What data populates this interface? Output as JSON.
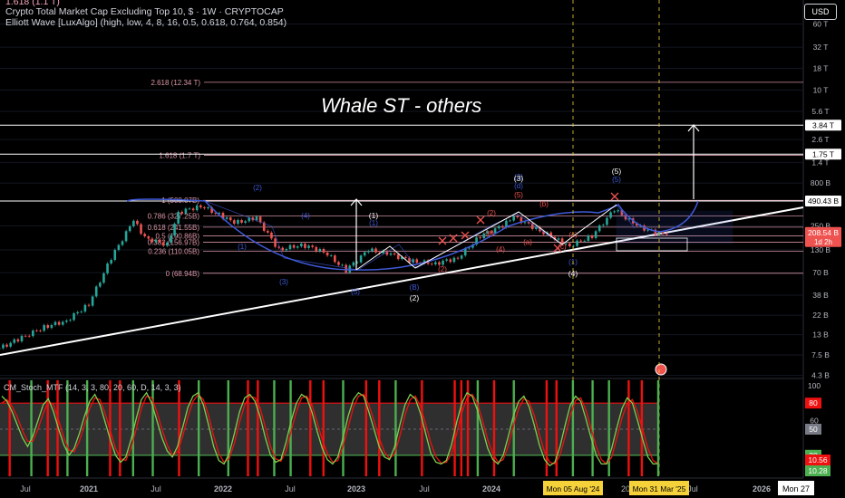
{
  "header": {
    "title": "Crypto Total Market Cap Excluding Top 10, $ · 1W · CRYPTOCAP",
    "indicator": "Elliott Wave [LuxAlgo] (high, low, 4, 8, 16, 0.5, 0.618, 0.764, 0.854)",
    "top_fib_cut": "1.618 (1.1 T)"
  },
  "currency_button": "USD",
  "annotation": "Whale ST - others",
  "colors": {
    "background": "#000000",
    "candle_up": "#26a69a",
    "candle_down": "#ef5350",
    "fib_line": "#f4a7b9",
    "wave_blue": "#3f5ad8",
    "wave_white": "#ffffff",
    "trendline": "#ffffff",
    "stoch_green": "#4caf50",
    "stoch_red": "#ef1010",
    "stoch_fill": "#555555",
    "date_highlight": "#f5d13a"
  },
  "chart_data": [
    {
      "type": "candlestick",
      "scale": "log",
      "ylim": [
        "4.3 B",
        "60 T"
      ],
      "y_ticks": [
        "60 T",
        "32 T",
        "18 T",
        "10 T",
        "5.6 T",
        "2.6 T",
        "1.4 T",
        "800 B",
        "490.43 B",
        "250 B",
        "130 B",
        "70 B",
        "38 B",
        "22 B",
        "13 B",
        "7.5 B",
        "4.3 B"
      ],
      "x_ticks": [
        "Jul",
        "2021",
        "Jul",
        "2022",
        "Jul",
        "2023",
        "Jul",
        "2024",
        "Jul",
        "20",
        "Jul",
        "2026",
        "Mon 27"
      ],
      "price_badges": [
        {
          "label": "3.84 T",
          "value": 3840
        },
        {
          "label": "1.75 T",
          "value": 1750
        },
        {
          "label": "490.43 B",
          "value": 490.43
        },
        {
          "label": "208.54 B",
          "value": 208.54,
          "sub": "1d 2h",
          "color": "#ef5350"
        }
      ],
      "fib_levels": [
        {
          "label": "2.618 (12.34 T)",
          "value": 12340
        },
        {
          "label": "1.618 (1.7 T)",
          "value": 1700
        },
        {
          "label": "1 (500.07B)",
          "value": 500
        },
        {
          "label": "0.786 (327.25B)",
          "value": 327
        },
        {
          "label": "0.618 (241.55B)",
          "value": 241
        },
        {
          "label": "0.5 (190.86B)",
          "value": 190
        },
        {
          "label": "0.382 (156.97B)",
          "value": 160
        },
        {
          "label": "0.236 (110.05B)",
          "value": 125
        },
        {
          "label": "0 (68.94B)",
          "value": 68.94
        }
      ],
      "close_series": [
        [
          "2020-05",
          9
        ],
        [
          "2020-07",
          12
        ],
        [
          "2020-09",
          16
        ],
        [
          "2020-11",
          19
        ],
        [
          "2021-01",
          30
        ],
        [
          "2021-03",
          105
        ],
        [
          "2021-05",
          290
        ],
        [
          "2021-06",
          180
        ],
        [
          "2021-08",
          150
        ],
        [
          "2021-09",
          360
        ],
        [
          "2021-11",
          430
        ],
        [
          "2022-01",
          320
        ],
        [
          "2022-02",
          270
        ],
        [
          "2022-04",
          310
        ],
        [
          "2022-06",
          130
        ],
        [
          "2022-08",
          150
        ],
        [
          "2022-10",
          125
        ],
        [
          "2022-12",
          75
        ],
        [
          "2023-02",
          130
        ],
        [
          "2023-04",
          115
        ],
        [
          "2023-06",
          95
        ],
        [
          "2023-08",
          90
        ],
        [
          "2023-10",
          105
        ],
        [
          "2023-12",
          190
        ],
        [
          "2024-02",
          250
        ],
        [
          "2024-03",
          320
        ],
        [
          "2024-05",
          230
        ],
        [
          "2024-07",
          170
        ],
        [
          "2024-08",
          145
        ],
        [
          "2024-10",
          190
        ],
        [
          "2024-12",
          390
        ],
        [
          "2025-02",
          250
        ],
        [
          "2025-04",
          200
        ],
        [
          "2025-05",
          208.54
        ]
      ],
      "wave_labels": {
        "blue": [
          "(2)",
          "(4)",
          "(1)",
          "(3)",
          "(5)",
          "(B)",
          "(d)",
          "(5)",
          "(3)",
          "(1)",
          "(1)"
        ],
        "white": [
          "(1)",
          "(2)",
          "(3)",
          "(4)",
          "(5)"
        ],
        "red": [
          "(2)",
          "(4)",
          "(b)",
          "(a)",
          "(5)",
          "(2)",
          "(c)",
          "(c)",
          "(e)"
        ]
      },
      "projection_targets": [
        "3.84 T",
        "1.75 T"
      ]
    },
    {
      "type": "line",
      "name": "CM_Stoch_MTF (14, 3, 3, 80, 20, 60, D, 14, 3, 3)",
      "ylim": [
        0,
        100
      ],
      "y_ticks": [
        "100",
        "60",
        "0"
      ],
      "levels": [
        {
          "label": "80",
          "value": 80,
          "color": "#ef1010"
        },
        {
          "label": "50",
          "value": 50,
          "color": "#787b86"
        },
        {
          "label": "20",
          "value": 20,
          "color": "#4caf50"
        }
      ],
      "badges": [
        {
          "label": "10.56",
          "value": 10.56,
          "color": "#ef1010"
        },
        {
          "label": "10.28",
          "value": 10.28,
          "color": "#4caf50"
        }
      ],
      "series_k": [
        88,
        82,
        70,
        55,
        40,
        30,
        42,
        60,
        78,
        85,
        70,
        50,
        32,
        20,
        28,
        45,
        65,
        82,
        90,
        78,
        58,
        38,
        20,
        12,
        18,
        38,
        62,
        84,
        92,
        80,
        60,
        40,
        25,
        18,
        30,
        52,
        75,
        88,
        92,
        78,
        55,
        30,
        14,
        10,
        22,
        45,
        70,
        86,
        90,
        82,
        64,
        40,
        20,
        12,
        15,
        35,
        60,
        80,
        90,
        86,
        70,
        48,
        28,
        15,
        10,
        18,
        40,
        65,
        84,
        92,
        88,
        70,
        50,
        30,
        18,
        15,
        30,
        55,
        78,
        90,
        85,
        68,
        45,
        22,
        12,
        10,
        14,
        32,
        58,
        80,
        92,
        88,
        72,
        50,
        28,
        15,
        10,
        20,
        42,
        66,
        82,
        88,
        76,
        55,
        32,
        15,
        8,
        12,
        30,
        55,
        78,
        88,
        82,
        62,
        40,
        20,
        10,
        10,
        28,
        52,
        74,
        86,
        80,
        60,
        38,
        18,
        10,
        10.56
      ],
      "series_d": [
        80,
        84,
        76,
        64,
        48,
        36,
        36,
        50,
        68,
        82,
        78,
        60,
        40,
        26,
        24,
        36,
        55,
        74,
        86,
        84,
        68,
        48,
        28,
        16,
        14,
        28,
        50,
        74,
        88,
        86,
        70,
        50,
        32,
        20,
        24,
        42,
        64,
        82,
        90,
        84,
        66,
        42,
        22,
        12,
        16,
        34,
        58,
        78,
        88,
        86,
        74,
        52,
        30,
        16,
        13,
        25,
        48,
        70,
        86,
        88,
        78,
        58,
        38,
        22,
        12,
        14,
        30,
        52,
        75,
        88,
        90,
        78,
        60,
        40,
        24,
        16,
        22,
        42,
        66,
        84,
        88,
        76,
        56,
        34,
        18,
        11,
        12,
        22,
        45,
        69,
        86,
        90,
        80,
        60,
        38,
        22,
        12,
        15,
        31,
        54,
        74,
        85,
        82,
        66,
        44,
        24,
        12,
        10,
        20,
        42,
        66,
        83,
        86,
        72,
        51,
        30,
        15,
        10,
        18,
        40,
        63,
        80,
        84,
        70,
        49,
        28,
        14,
        10.28
      ],
      "signal_bars": [
        {
          "x": 0.012,
          "c": "red"
        },
        {
          "x": 0.045,
          "c": "green"
        },
        {
          "x": 0.07,
          "c": "red"
        },
        {
          "x": 0.085,
          "c": "red"
        },
        {
          "x": 0.1,
          "c": "green"
        },
        {
          "x": 0.13,
          "c": "green"
        },
        {
          "x": 0.165,
          "c": "red"
        },
        {
          "x": 0.18,
          "c": "red"
        },
        {
          "x": 0.2,
          "c": "green"
        },
        {
          "x": 0.23,
          "c": "green"
        },
        {
          "x": 0.27,
          "c": "red"
        },
        {
          "x": 0.3,
          "c": "green"
        },
        {
          "x": 0.345,
          "c": "green"
        },
        {
          "x": 0.375,
          "c": "red"
        },
        {
          "x": 0.39,
          "c": "red"
        },
        {
          "x": 0.415,
          "c": "green"
        },
        {
          "x": 0.44,
          "c": "green"
        },
        {
          "x": 0.47,
          "c": "red"
        },
        {
          "x": 0.49,
          "c": "red"
        },
        {
          "x": 0.52,
          "c": "green"
        },
        {
          "x": 0.555,
          "c": "red"
        },
        {
          "x": 0.575,
          "c": "red"
        },
        {
          "x": 0.6,
          "c": "green"
        },
        {
          "x": 0.64,
          "c": "red"
        },
        {
          "x": 0.69,
          "c": "red"
        },
        {
          "x": 0.7,
          "c": "red"
        },
        {
          "x": 0.71,
          "c": "red"
        },
        {
          "x": 0.725,
          "c": "green"
        },
        {
          "x": 0.75,
          "c": "red"
        },
        {
          "x": 0.78,
          "c": "green"
        },
        {
          "x": 0.83,
          "c": "red"
        },
        {
          "x": 0.845,
          "c": "red"
        },
        {
          "x": 0.87,
          "c": "green"
        },
        {
          "x": 0.9,
          "c": "green"
        },
        {
          "x": 0.925,
          "c": "green"
        },
        {
          "x": 0.955,
          "c": "red"
        },
        {
          "x": 0.975,
          "c": "red"
        },
        {
          "x": 1.0,
          "c": "green"
        }
      ]
    }
  ],
  "date_markers": [
    "Mon 05 Aug '24",
    "Mon 31 Mar '25"
  ]
}
